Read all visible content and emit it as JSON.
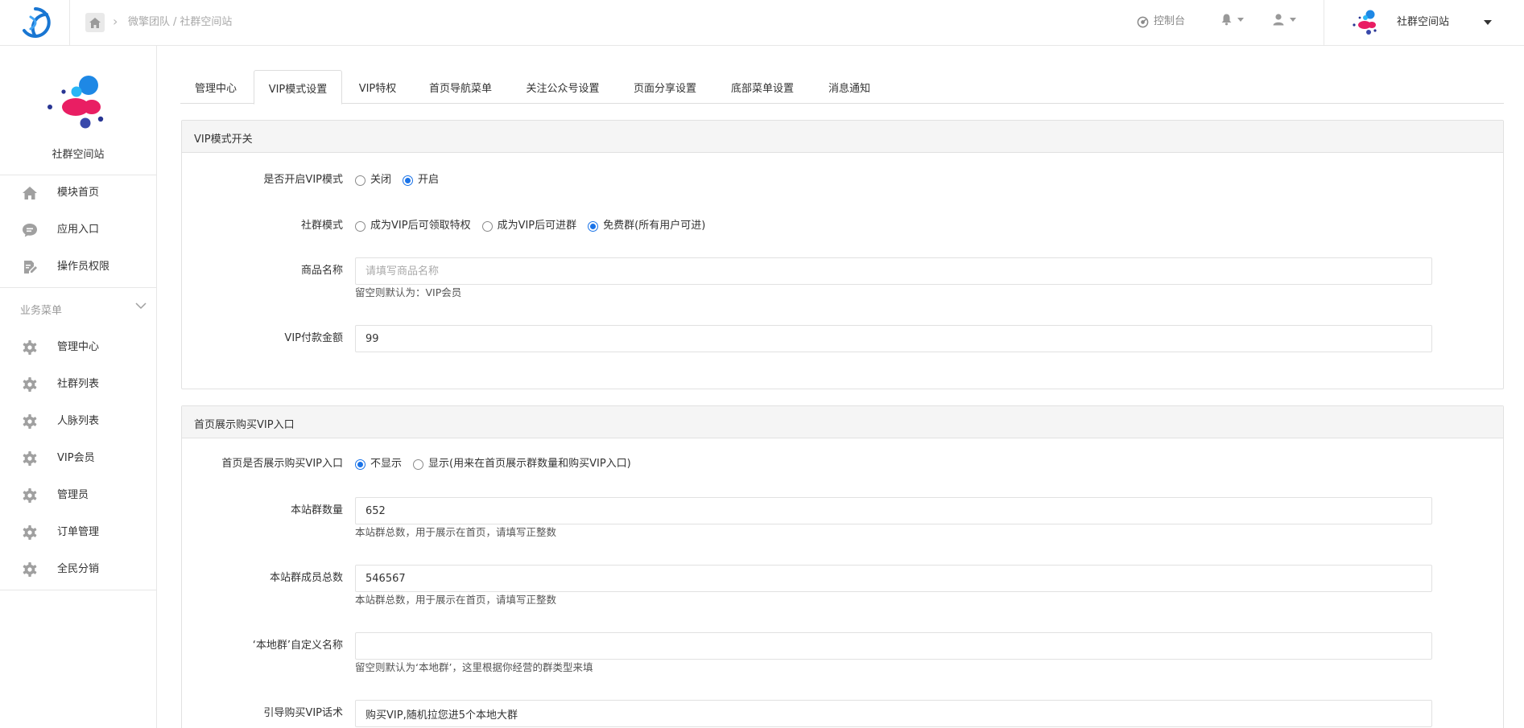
{
  "header": {
    "breadcrumb": [
      "微擎团队",
      "社群空间站"
    ],
    "console_label": "控制台",
    "brand_name": "社群空间站"
  },
  "sidebar": {
    "site_name": "社群空间站",
    "top_items": [
      {
        "label": "模块首页",
        "icon": "home-icon"
      },
      {
        "label": "应用入口",
        "icon": "chat-icon"
      },
      {
        "label": "操作员权限",
        "icon": "edit-doc-icon"
      }
    ],
    "section_title": "业务菜单",
    "business_items": [
      {
        "label": "管理中心",
        "icon": "gear-icon"
      },
      {
        "label": "社群列表",
        "icon": "gear-icon"
      },
      {
        "label": "人脉列表",
        "icon": "gear-icon"
      },
      {
        "label": "VIP会员",
        "icon": "gear-icon"
      },
      {
        "label": "管理员",
        "icon": "gear-icon"
      },
      {
        "label": "订单管理",
        "icon": "gear-icon"
      },
      {
        "label": "全民分销",
        "icon": "gear-icon"
      }
    ]
  },
  "tabs": [
    "管理中心",
    "VIP模式设置",
    "VIP特权",
    "首页导航菜单",
    "关注公众号设置",
    "页面分享设置",
    "底部菜单设置",
    "消息通知"
  ],
  "active_tab": "VIP模式设置",
  "vip_panel": {
    "title": "VIP模式开关",
    "vip_mode": {
      "label": "是否开启VIP模式",
      "options": [
        "关闭",
        "开启"
      ],
      "selected": "开启"
    },
    "group_mode": {
      "label": "社群模式",
      "options": [
        "成为VIP后可领取特权",
        "成为VIP后可进群",
        "免费群(所有用户可进)"
      ],
      "selected": "免费群(所有用户可进)"
    },
    "product_name": {
      "label": "商品名称",
      "placeholder": "请填写商品名称",
      "value": "",
      "help": "留空则默认为：VIP会员"
    },
    "vip_amount": {
      "label": "VIP付款金额",
      "value": "99"
    }
  },
  "home_panel": {
    "title": "首页展示购买VIP入口",
    "show_entry": {
      "label": "首页是否展示购买VIP入口",
      "options": [
        "不显示",
        "显示(用来在首页展示群数量和购买VIP入口)"
      ],
      "selected": "不显示"
    },
    "group_count": {
      "label": "本站群数量",
      "value": "652",
      "help": "本站群总数，用于展示在首页，请填写正整数"
    },
    "member_total": {
      "label": "本站群成员总数",
      "value": "546567",
      "help": "本站群总数，用于展示在首页，请填写正整数"
    },
    "local_name": {
      "label": "‘本地群’自定义名称",
      "value": "",
      "help": "留空则默认为‘本地群’，这里根据你经营的群类型来填"
    },
    "guide_text": {
      "label": "引导购买VIP话术",
      "value": "购买VIP,随机拉您进5个本地大群"
    }
  },
  "colors": {
    "accent": "#1a73e8",
    "logo_blue": "#1e88e5",
    "logo_pink": "#e91e63",
    "logo_navy": "#283593"
  }
}
